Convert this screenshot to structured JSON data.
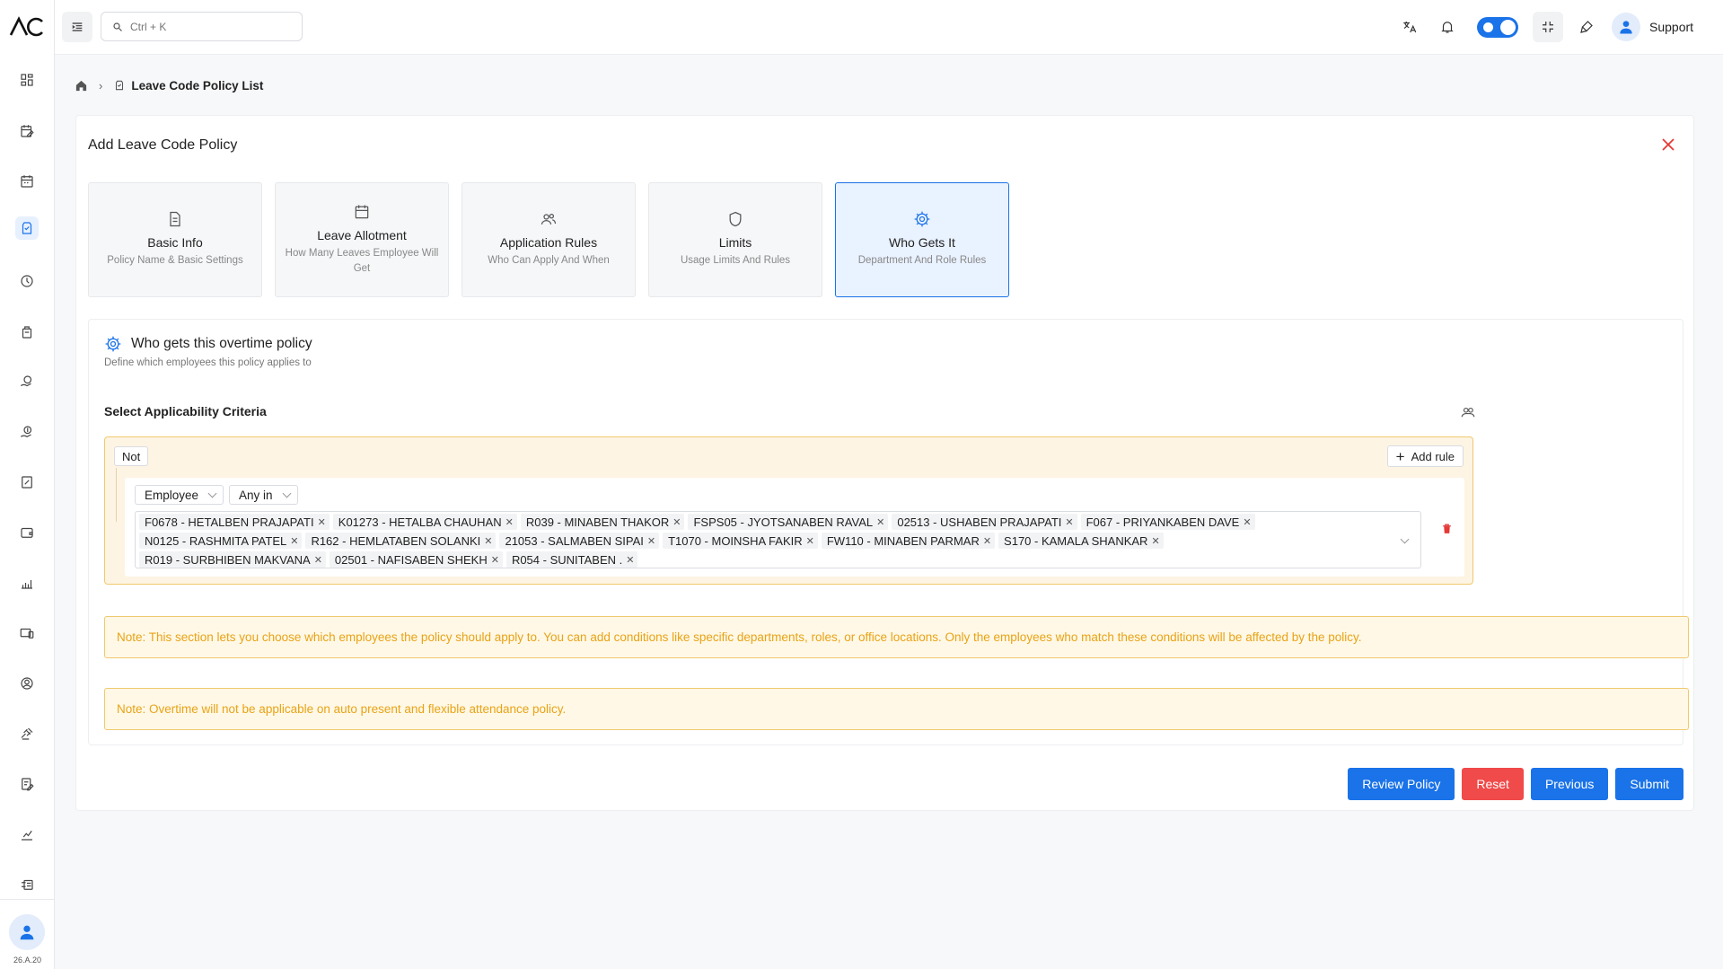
{
  "app": {
    "version": "26.A.20"
  },
  "search": {
    "placeholder": "Ctrl + K"
  },
  "header": {
    "user_name": "Support"
  },
  "breadcrumb": {
    "current": "Leave Code Policy List"
  },
  "card": {
    "title": "Add Leave Code Policy"
  },
  "steps": [
    {
      "title": "Basic Info",
      "sub": "Policy Name & Basic Settings"
    },
    {
      "title": "Leave Allotment",
      "sub": "How Many Leaves Employee Will Get"
    },
    {
      "title": "Application Rules",
      "sub": "Who Can Apply And When"
    },
    {
      "title": "Limits",
      "sub": "Usage Limits And Rules"
    },
    {
      "title": "Who Gets It",
      "sub": "Department And Role Rules"
    }
  ],
  "section": {
    "title": "Who gets this overtime policy",
    "subtitle": "Define which employees this policy applies to",
    "criteria_label": "Select Applicability Criteria"
  },
  "rule_group": {
    "not_label": "Not",
    "add_rule_label": "Add rule",
    "field": "Employee",
    "operator": "Any in",
    "tags": [
      "F0678 - HETALBEN PRAJAPATI",
      "K01273 - HETALBA CHAUHAN",
      "R039 - MINABEN THAKOR",
      "FSPS05 - JYOTSANABEN RAVAL",
      "02513 - USHABEN PRAJAPATI",
      "F067 - PRIYANKABEN DAVE",
      "N0125 - RASHMITA PATEL",
      "R162 - HEMLATABEN SOLANKI",
      "21053 - SALMABEN SIPAI",
      "T1070 - MOINSHA FAKIR",
      "FW110 - MINABEN PARMAR",
      "S170 - KAMALA SHANKAR",
      "R019 - SURBHIBEN MAKVANA",
      "02501 - NAFISABEN SHEKH",
      "R054 - SUNITABEN ."
    ]
  },
  "notes": {
    "note1": "Note: This section lets you choose which employees the policy should apply to. You can add conditions like specific departments, roles, or office locations. Only the employees who match these conditions will be affected by the policy.",
    "note2": "Note: Overtime will not be applicable on auto present and flexible attendance policy."
  },
  "actions": {
    "review": "Review Policy",
    "reset": "Reset",
    "previous": "Previous",
    "submit": "Submit"
  },
  "colors": {
    "primary": "#1a73e8",
    "danger": "#f04a4a",
    "warning_text": "#e8a317"
  }
}
